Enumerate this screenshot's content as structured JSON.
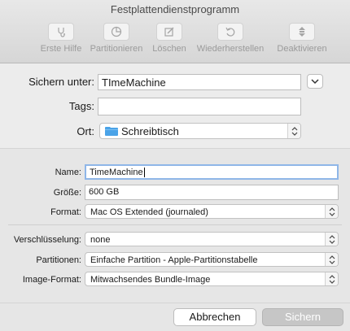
{
  "window": {
    "title": "Festplattendienstprogramm"
  },
  "toolbar": {
    "items": [
      {
        "label": "Erste Hilfe",
        "icon": "stethoscope-icon"
      },
      {
        "label": "Partitionieren",
        "icon": "pie-chart-icon"
      },
      {
        "label": "Löschen",
        "icon": "erase-icon"
      },
      {
        "label": "Wiederherstellen",
        "icon": "restore-icon"
      },
      {
        "label": "Deaktivieren",
        "icon": "unmount-icon"
      }
    ]
  },
  "save_panel": {
    "save_as_label": "Sichern unter:",
    "save_as_value": "TImeMachine",
    "tags_label": "Tags:",
    "tags_value": "",
    "location_label": "Ort:",
    "location_value": "Schreibtisch"
  },
  "options": {
    "name_label": "Name:",
    "name_value": "TimeMachine",
    "size_label": "Größe:",
    "size_value": "600 GB",
    "format_label": "Format:",
    "format_value": "Mac OS Extended (journaled)",
    "encryption_label": "Verschlüsselung:",
    "encryption_value": "none",
    "partitions_label": "Partitionen:",
    "partitions_value": "Einfache Partition - Apple-Partitionstabelle",
    "image_format_label": "Image-Format:",
    "image_format_value": "Mitwachsendes Bundle-Image"
  },
  "buttons": {
    "cancel": "Abbrechen",
    "save": "Sichern"
  },
  "colors": {
    "accent": "#8fb6e8",
    "folder": "#4aa3e8",
    "disabled_button": "#c6c6c6"
  }
}
